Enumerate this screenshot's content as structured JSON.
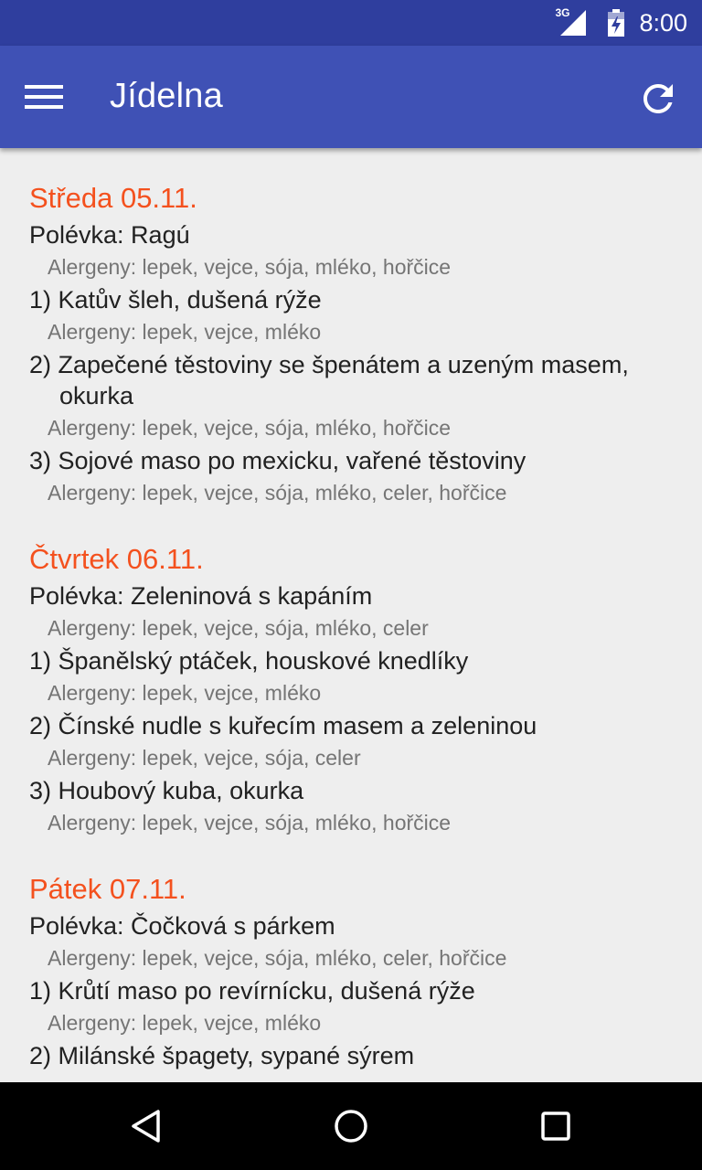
{
  "status_bar": {
    "network": "3G",
    "time": "8:00"
  },
  "app_bar": {
    "title": "Jídelna",
    "menu_icon": "hamburger-menu-icon",
    "refresh_icon": "refresh-icon"
  },
  "colors": {
    "status_bar": "#2f3e9e",
    "app_bar": "#3f51b5",
    "day_title": "#f4511e",
    "dish_text": "#212121",
    "allergen_text": "#757575",
    "background": "#eeeeee"
  },
  "days": [
    {
      "title": "Středa 05.11.",
      "items": [
        {
          "dish": "Polévka: Ragú",
          "allergens": "Alergeny: lepek, vejce, sója, mléko, hořčice"
        },
        {
          "dish": "1) Katův šleh, dušená rýže",
          "allergens": "Alergeny: lepek, vejce, mléko"
        },
        {
          "dish": "2) Zapečené těstoviny se špenátem a uzeným masem, okurka",
          "allergens": "Alergeny: lepek, vejce, sója, mléko, hořčice"
        },
        {
          "dish": "3) Sojové maso po mexicku, vařené těstoviny",
          "allergens": "Alergeny: lepek, vejce, sója, mléko, celer, hořčice"
        }
      ]
    },
    {
      "title": "Čtvrtek 06.11.",
      "items": [
        {
          "dish": "Polévka: Zeleninová s kapáním",
          "allergens": "Alergeny: lepek, vejce, sója, mléko, celer"
        },
        {
          "dish": "1) Španělský ptáček, houskové knedlíky",
          "allergens": "Alergeny: lepek, vejce, mléko"
        },
        {
          "dish": "2) Čínské nudle s kuřecím masem a zeleninou",
          "allergens": "Alergeny: lepek, vejce, sója, celer"
        },
        {
          "dish": "3) Houbový kuba, okurka",
          "allergens": "Alergeny: lepek, vejce, sója, mléko, hořčice"
        }
      ]
    },
    {
      "title": "Pátek 07.11.",
      "items": [
        {
          "dish": "Polévka: Čočková s párkem",
          "allergens": "Alergeny: lepek, vejce, sója, mléko, celer, hořčice"
        },
        {
          "dish": "1) Krůtí maso po revírnícku, dušená rýže",
          "allergens": "Alergeny: lepek, vejce, mléko"
        },
        {
          "dish": "2) Milánské špagety, sypané sýrem",
          "allergens": ""
        }
      ]
    }
  ],
  "nav_bar": {
    "back_icon": "back-triangle-icon",
    "home_icon": "home-circle-icon",
    "recents_icon": "recents-square-icon"
  }
}
